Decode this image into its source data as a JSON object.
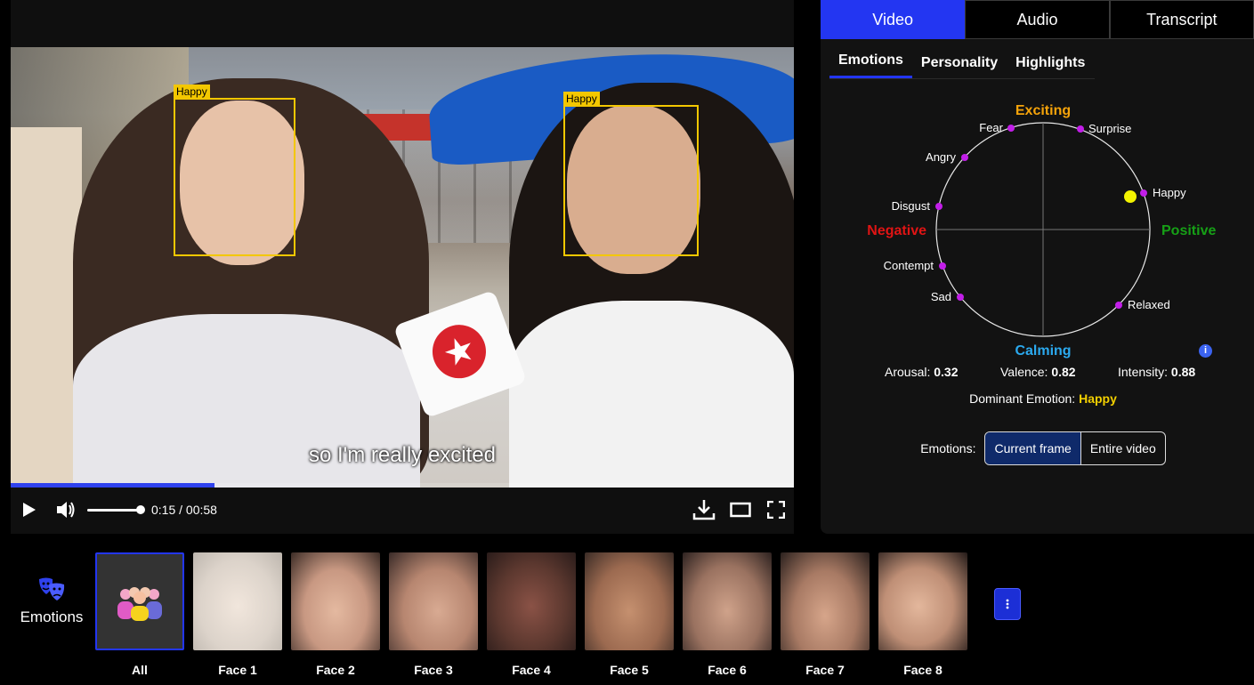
{
  "player": {
    "subtitle": "so I'm really excited",
    "time": "0:15 / 00:58",
    "progress": 0.26,
    "icons": {
      "play": "play-icon",
      "volume": "volume-icon",
      "download": "download-icon",
      "theater": "theater-mode-icon",
      "fullscreen": "fullscreen-icon"
    },
    "face_boxes": [
      {
        "label": "Happy"
      },
      {
        "label": "Happy"
      }
    ],
    "colors": {
      "box": "#f3c700",
      "progress": "#2f42ee"
    }
  },
  "panel": {
    "tabs": [
      "Video",
      "Audio",
      "Transcript"
    ],
    "active_tab": "Video",
    "subtabs": [
      "Emotions",
      "Personality",
      "Highlights"
    ],
    "active_subtab": "Emotions",
    "circumplex": {
      "top": "Exciting",
      "bottom": "Calming",
      "left": "Negative",
      "right": "Positive",
      "emotions": [
        "Fear",
        "Surprise",
        "Angry",
        "Happy",
        "Disgust",
        "Contempt",
        "Sad",
        "Relaxed"
      ],
      "colors": {
        "top": "#f5a30a",
        "bottom": "#2ba9ee",
        "left": "#e01414",
        "right": "#16a016",
        "marker": "#f3f300",
        "dot": "#c21ee8"
      }
    },
    "stats": {
      "arousal_label": "Arousal:",
      "arousal": "0.32",
      "valence_label": "Valence:",
      "valence": "0.82",
      "intensity_label": "Intensity:",
      "intensity": "0.88"
    },
    "dominant_label": "Dominant Emotion:",
    "dominant": "Happy",
    "emotions_label": "Emotions:",
    "mode_buttons": [
      "Current frame",
      "Entire video"
    ],
    "active_mode": "Current frame"
  },
  "faces": {
    "section_label": "Emotions",
    "items": [
      "All",
      "Face 1",
      "Face 2",
      "Face 3",
      "Face 4",
      "Face 5",
      "Face 6",
      "Face 7",
      "Face 8"
    ],
    "active": "All"
  }
}
